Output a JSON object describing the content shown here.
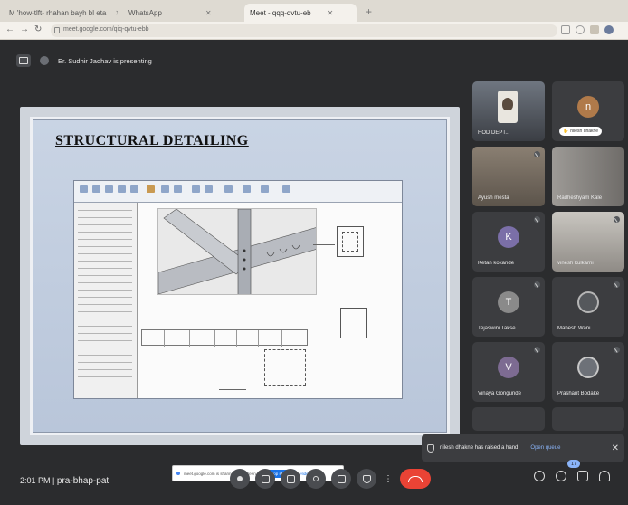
{
  "browser": {
    "tabs": [
      {
        "label": "M 'how-tlft- rhahan bayh bl eta",
        "active": false
      },
      {
        "label": "WhatsApp",
        "active": false
      },
      {
        "label": "Meet - qqq-qvtu-eb",
        "active": true
      }
    ],
    "url": "meet.google.com/qiq-qvtu-ebb"
  },
  "presentation": {
    "presenter_label": "Er. Sudhir Jadhav is presenting",
    "slide_title": "STRUCTURAL DETAILING",
    "share_notice": "meet.google.com is sharing your screen.",
    "stop_sharing_label": "Stop sharing",
    "hide_label": "Hide"
  },
  "participants": [
    {
      "name": "HOD DEPT...",
      "initial": "",
      "kind": "photo",
      "color": "#4d5158"
    },
    {
      "name": "nilesh dhakne",
      "initial": "n",
      "kind": "avatar",
      "color": "#b07a4a",
      "pinned_chip": "nilesh dhakne"
    },
    {
      "name": "Ayush mesta",
      "initial": "",
      "kind": "photo",
      "color": "#7a6e62"
    },
    {
      "name": "Radheshyam Kale",
      "initial": "",
      "kind": "photo",
      "color": "#8c8a87"
    },
    {
      "name": "Ketan kokande",
      "initial": "K",
      "kind": "avatar",
      "color": "#7b6fa8"
    },
    {
      "name": "vinesh kulkarni",
      "initial": "",
      "kind": "photo",
      "color": "#b4b0aa"
    },
    {
      "name": "Tejaswini Takse...",
      "initial": "T",
      "kind": "avatar",
      "color": "#8a8a8a"
    },
    {
      "name": "Mahesh Wani",
      "initial": "",
      "kind": "photo",
      "color": "#5d5f62"
    },
    {
      "name": "Vinaya Gongunde",
      "initial": "V",
      "kind": "avatar",
      "color": "#7d6b92"
    },
    {
      "name": "Prashant Bodake",
      "initial": "",
      "kind": "photo",
      "color": "#6d7178"
    }
  ],
  "notification": {
    "text": "nilesh dhakne has raised a hand",
    "action": "Open queue"
  },
  "footer": {
    "time": "2:01 PM",
    "separator": "|",
    "meeting_code": "pra-bhap-pat",
    "people_count": "17"
  },
  "colors": {
    "meet_bg": "#2b2c2e",
    "tile_bg": "#3c3d40",
    "end_call": "#ea4335",
    "accent": "#8ab4f8"
  }
}
